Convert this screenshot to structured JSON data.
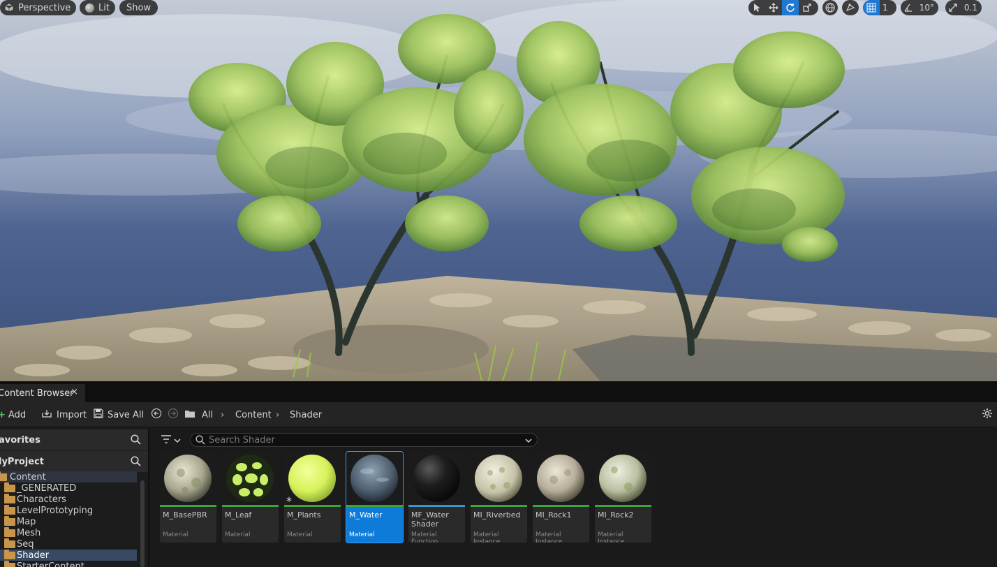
{
  "viewport": {
    "perspective_label": "Perspective",
    "lit_label": "Lit",
    "show_label": "Show",
    "grid_snap_value": "1",
    "rotation_snap_value": "10°",
    "scale_snap_value": "0.1",
    "icons": [
      "select-icon",
      "move-icon",
      "rotate-icon",
      "scale-icon",
      "world-icon",
      "surface-snap-icon",
      "grid-icon",
      "angle-icon",
      "scale-snap-icon"
    ]
  },
  "content_browser": {
    "tab_title": "Content Browser",
    "tab_close": "×",
    "toolbar": {
      "add_label": "Add",
      "import_label": "Import",
      "save_all_label": "Save All"
    },
    "breadcrumb": [
      "All",
      "Content",
      "Shader"
    ],
    "favorites_label": "avorites",
    "project_label": "lyProject",
    "tree": [
      {
        "label": "Content",
        "selected": false
      },
      {
        "label": "_GENERATED",
        "selected": false
      },
      {
        "label": "Characters",
        "selected": false
      },
      {
        "label": "LevelPrototyping",
        "selected": false
      },
      {
        "label": "Map",
        "selected": false
      },
      {
        "label": "Mesh",
        "selected": false
      },
      {
        "label": "Seq",
        "selected": false
      },
      {
        "label": "Shader",
        "selected": true
      },
      {
        "label": "StarterContent",
        "selected": false
      }
    ],
    "search_placeholder": "Search Shader",
    "assets": [
      {
        "name": "M_BasePBR",
        "type": "Material",
        "bar_color": "#3aa63a"
      },
      {
        "name": "M_Leaf",
        "type": "Material",
        "bar_color": "#3aa63a"
      },
      {
        "name": "M_Plants",
        "type": "Material",
        "bar_color": "#3aa63a"
      },
      {
        "name": "M_Water",
        "type": "Material",
        "bar_color": "#3aa63a",
        "selected": true
      },
      {
        "name": "MF_Water Shader",
        "type": "Material Function",
        "bar_color": "#2f9bd6"
      },
      {
        "name": "MI_Riverbed",
        "type": "Material Instance",
        "bar_color": "#3aa63a"
      },
      {
        "name": "MI_Rock1",
        "type": "Material Instance",
        "bar_color": "#3aa63a"
      },
      {
        "name": "MI_Rock2",
        "type": "Material Instance",
        "bar_color": "#3aa63a"
      }
    ]
  },
  "colors": {
    "accent": "#1f78d1",
    "selection": "#0f7bd8",
    "folder": "#c8964a"
  }
}
